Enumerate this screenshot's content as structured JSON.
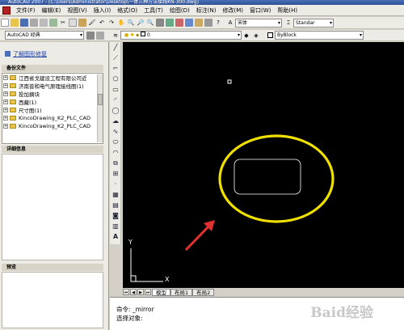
{
  "window": {
    "title": "AutoCAD 2007 - [C:\\Users\\Administrator\\Desktop\\一体三种方法接线KN-300.dwg]"
  },
  "menu": [
    "文件(F)",
    "编辑(E)",
    "视图(V)",
    "插入(I)",
    "格式(O)",
    "工具(T)",
    "绘图(D)",
    "标注(N)",
    "修改(M)",
    "窗口(W)",
    "帮助(H)"
  ],
  "toolbar": {
    "workspace": "AutoCAD 经典",
    "font_combo": "宋体",
    "style_combo": "Standar",
    "layer_value": "0",
    "linetype_combo": "ByBlock"
  },
  "design_center": {
    "link_text": "了解图形修复",
    "backup_header": "备份文件",
    "tree": [
      "江西省戈建设工程有限公司近",
      "济南普和电气原理接线图(1)",
      "投加摘块",
      "西藏(1)",
      "尺寸图(1)",
      "KincoDrawing_K2_PLC_CAD",
      "KincoDrawing_K2_PLC_CAD"
    ],
    "details_header": "详细信息",
    "preview_header": "预览"
  },
  "layout_tabs": [
    "模型",
    "布局1",
    "布局2"
  ],
  "command": {
    "line1": "命令: _mirror",
    "line2": "选择对象:"
  },
  "axes": {
    "x": "X",
    "y": "Y"
  },
  "watermark": "Baid经验"
}
